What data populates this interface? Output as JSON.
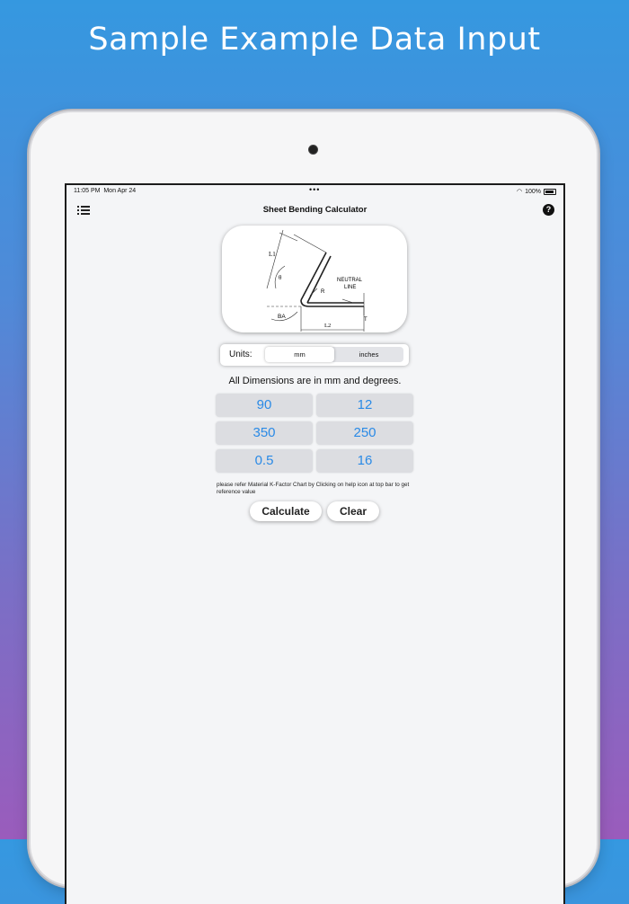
{
  "promo": {
    "headline": "Sample Example Data Input"
  },
  "status_bar": {
    "time": "11:05 PM",
    "date": "Mon Apr 24",
    "battery": "100%"
  },
  "nav": {
    "title": "Sheet Bending Calculator",
    "help_label": "?"
  },
  "diagram": {
    "labels": {
      "l1": "L1",
      "theta": "θ",
      "r": "R",
      "neutral1": "NEUTRAL",
      "neutral2": "LINE",
      "ba": "BA",
      "l2": "L2",
      "t": "T"
    }
  },
  "units": {
    "label": "Units:",
    "options": [
      "mm",
      "inches"
    ],
    "selected": "mm"
  },
  "info_text": "All Dimensions are in mm and degrees.",
  "inputs": [
    {
      "value": "90"
    },
    {
      "value": "12"
    },
    {
      "value": "350"
    },
    {
      "value": "250"
    },
    {
      "value": "0.5"
    },
    {
      "value": "16"
    }
  ],
  "note": "please refer Material K-Factor Chart by Clicking on help icon at top bar to get reference value",
  "buttons": {
    "calculate": "Calculate",
    "clear": "Clear"
  },
  "colors": {
    "accent": "#2a8ae6",
    "field_bg": "#dcdde1"
  }
}
